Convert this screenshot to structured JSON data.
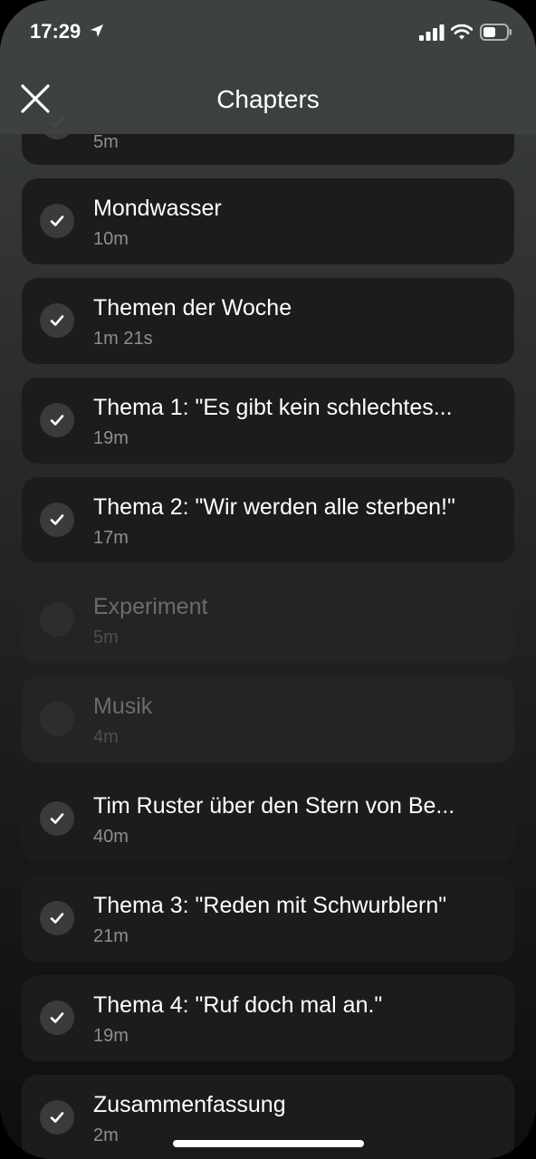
{
  "status_bar": {
    "time": "17:29"
  },
  "header": {
    "title": "Chapters"
  },
  "chapters": [
    {
      "title": "",
      "duration": "5m",
      "played": true
    },
    {
      "title": "Mondwasser",
      "duration": "10m",
      "played": true
    },
    {
      "title": "Themen der Woche",
      "duration": "1m 21s",
      "played": true
    },
    {
      "title": "Thema 1: \"Es gibt kein schlechtes...",
      "duration": "19m",
      "played": true
    },
    {
      "title": "Thema 2: \"Wir werden alle sterben!\"",
      "duration": "17m",
      "played": true
    },
    {
      "title": "Experiment",
      "duration": "5m",
      "played": false
    },
    {
      "title": "Musik",
      "duration": "4m",
      "played": false
    },
    {
      "title": "Tim Ruster über den Stern von Be...",
      "duration": "40m",
      "played": true
    },
    {
      "title": "Thema  3: \"Reden mit Schwurblern\"",
      "duration": "21m",
      "played": true
    },
    {
      "title": "Thema 4: \"Ruf doch mal an.\"",
      "duration": "19m",
      "played": true
    },
    {
      "title": "Zusammenfassung",
      "duration": "2m",
      "played": true
    }
  ]
}
